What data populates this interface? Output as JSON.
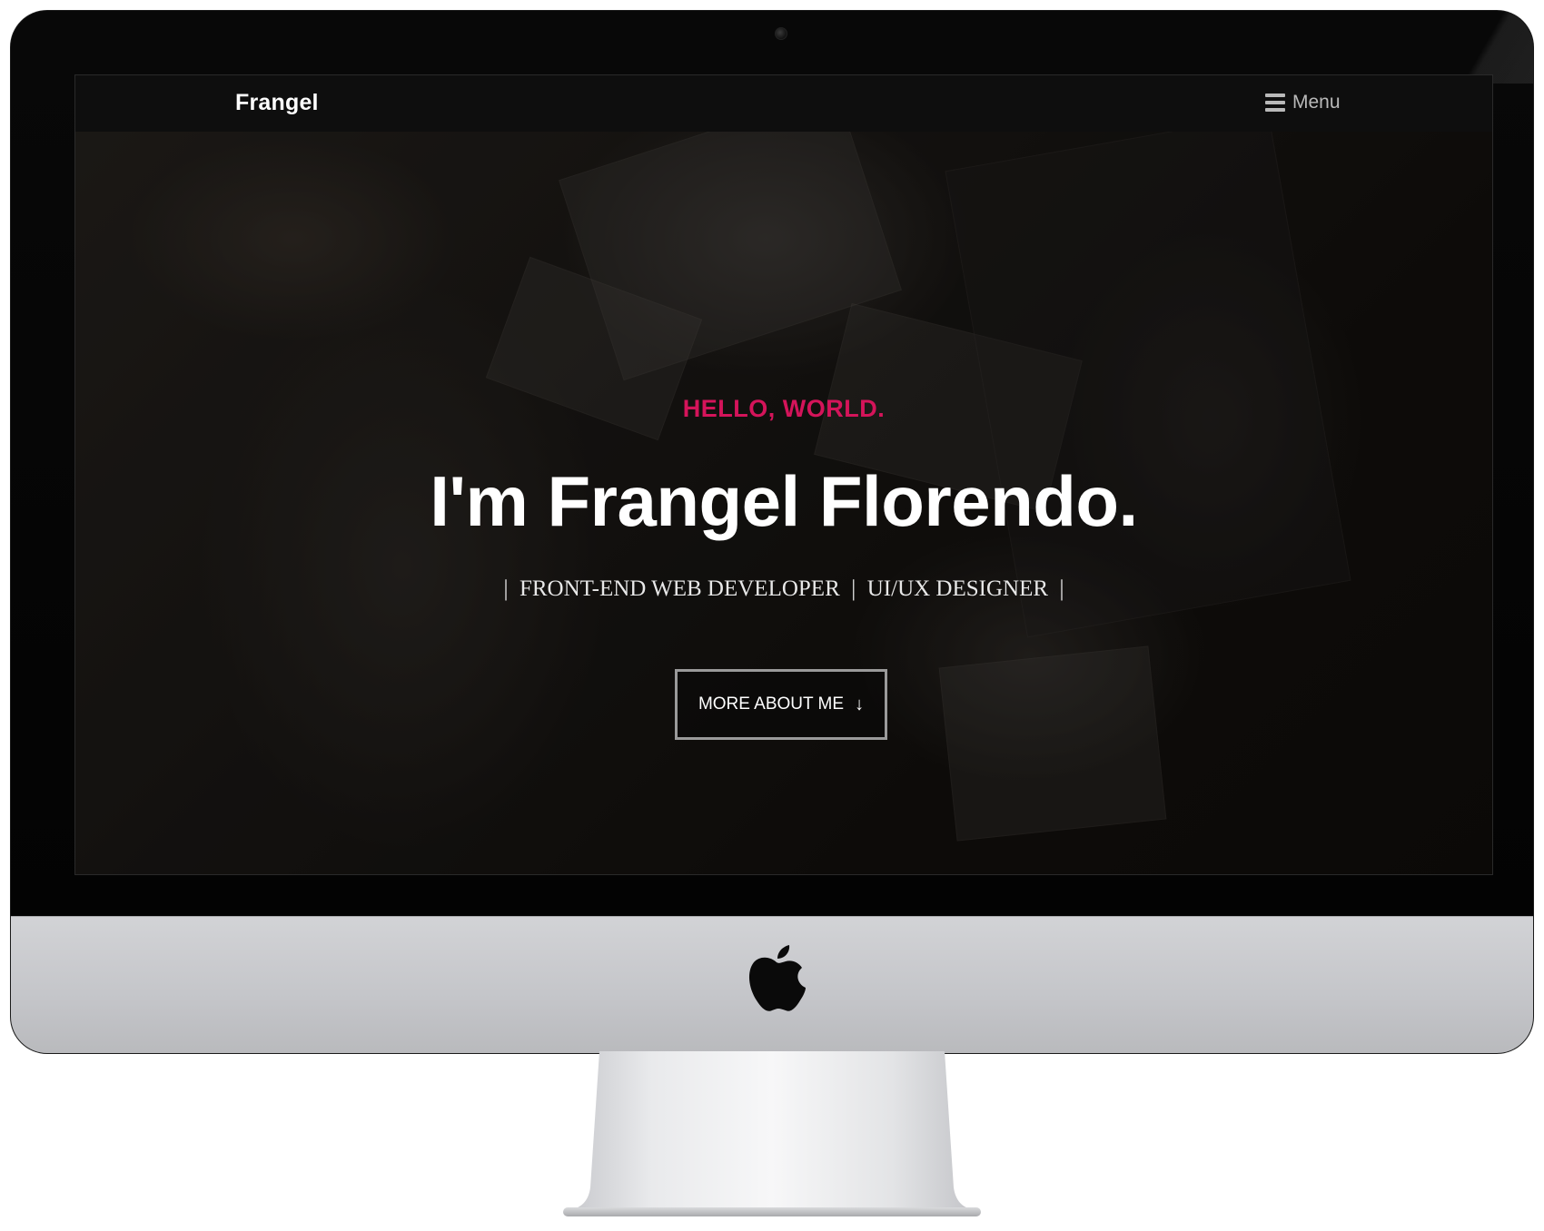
{
  "nav": {
    "brand": "Frangel",
    "menu_label": "Menu",
    "menu_icon": "hamburger-icon"
  },
  "hero": {
    "greeting": "HELLO, WORLD.",
    "headline": "I'm Frangel Florendo.",
    "subtitle": "|  FRONT-END WEB DEVELOPER  |  UI/UX DESIGNER  |",
    "cta_label": "MORE ABOUT ME",
    "cta_icon": "arrow-down-icon",
    "cta_arrow": "↓"
  },
  "colors": {
    "accent": "#d4145a",
    "nav_bg": "#0e0e0e",
    "text": "#ffffff"
  },
  "device": {
    "logo": "apple-logo"
  }
}
